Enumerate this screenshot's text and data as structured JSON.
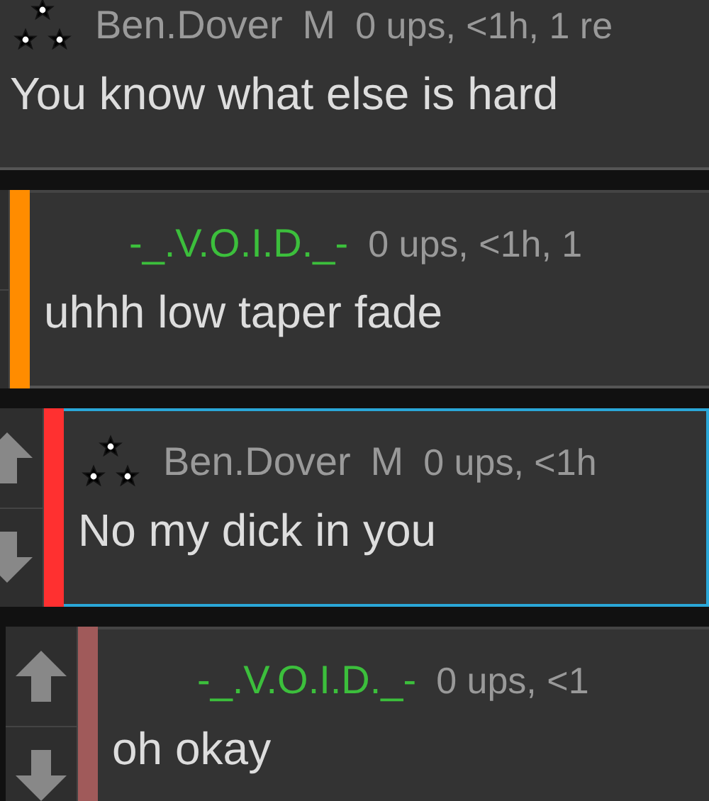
{
  "comments": [
    {
      "author": {
        "name": "Ben.Dover",
        "color": "#9a9a9a"
      },
      "rank_icon": true,
      "gender": "M",
      "meta": "0 ups, <1h, 1 re",
      "text": "You know what else is hard",
      "selected": false,
      "children": [
        {
          "author": {
            "name": "-_.V.O.I.D._-",
            "color": "#3cbf3c"
          },
          "rank_icon": false,
          "meta": "0 ups, <1h, 1",
          "text": "uhhh low taper fade",
          "color": "#ff8c00",
          "selected": false,
          "children": [
            {
              "author": {
                "name": "Ben.Dover",
                "color": "#9a9a9a"
              },
              "rank_icon": true,
              "gender": "M",
              "meta": "0 ups, <1h",
              "text": "No my dick in you",
              "color": "#ff3030",
              "selected": true,
              "children": [
                {
                  "author": {
                    "name": "-_.V.O.I.D._-",
                    "color": "#3cbf3c"
                  },
                  "rank_icon": false,
                  "meta": "0 ups, <1",
                  "text": "oh okay",
                  "color": "#a05a5a",
                  "selected": false
                }
              ]
            }
          ]
        }
      ]
    }
  ]
}
